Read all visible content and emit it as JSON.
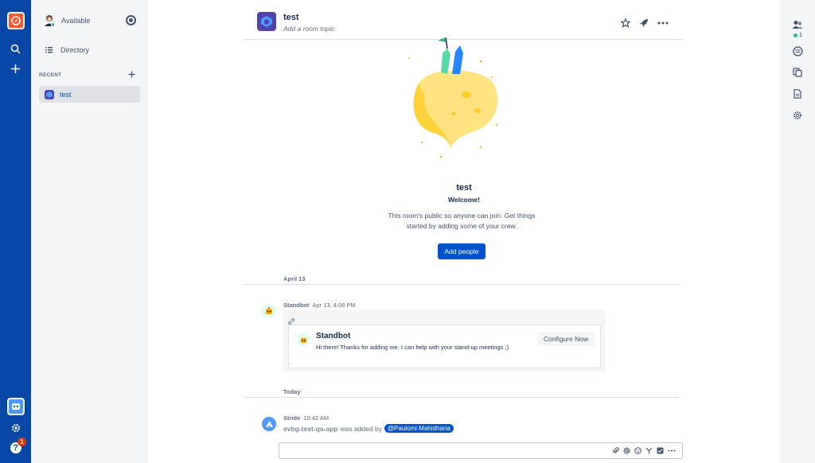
{
  "sidebar": {
    "status_label": "Available",
    "directory_label": "Directory",
    "recent_label": "RECENT",
    "rooms": [
      {
        "label": "test"
      }
    ]
  },
  "global_nav": {
    "help_badge": "1"
  },
  "right_rail": {
    "member_count": "1"
  },
  "header": {
    "title": "test",
    "topic_placeholder": "Add a room topic"
  },
  "welcome": {
    "title": "test",
    "subtitle": "Welcome!",
    "description": "This room's public so anyone can join. Get things started by adding some of your crew.",
    "add_people_label": "Add people"
  },
  "timeline": {
    "dates": [
      "April 13",
      "Today"
    ],
    "messages": [
      {
        "sender": "Standbot",
        "time": "Apr 13, 4:08 PM",
        "card": {
          "title": "Standbot",
          "text": "Hi there! Thanks for adding me. I can help with your stand-up meetings ;)",
          "button_label": "Configure Now"
        }
      },
      {
        "sender": "Stride",
        "time": "10:42 AM",
        "app_name": "evbg-test-qa-app",
        "action_text": "was added by",
        "mention": "@Paulomi Mahidharia"
      }
    ]
  },
  "composer": {
    "value": ""
  },
  "colors": {
    "nav_blue": "#0747a6",
    "primary": "#0052cc",
    "sidebar_bg": "#f4f5f7",
    "success": "#36b37e",
    "danger": "#de350b"
  }
}
